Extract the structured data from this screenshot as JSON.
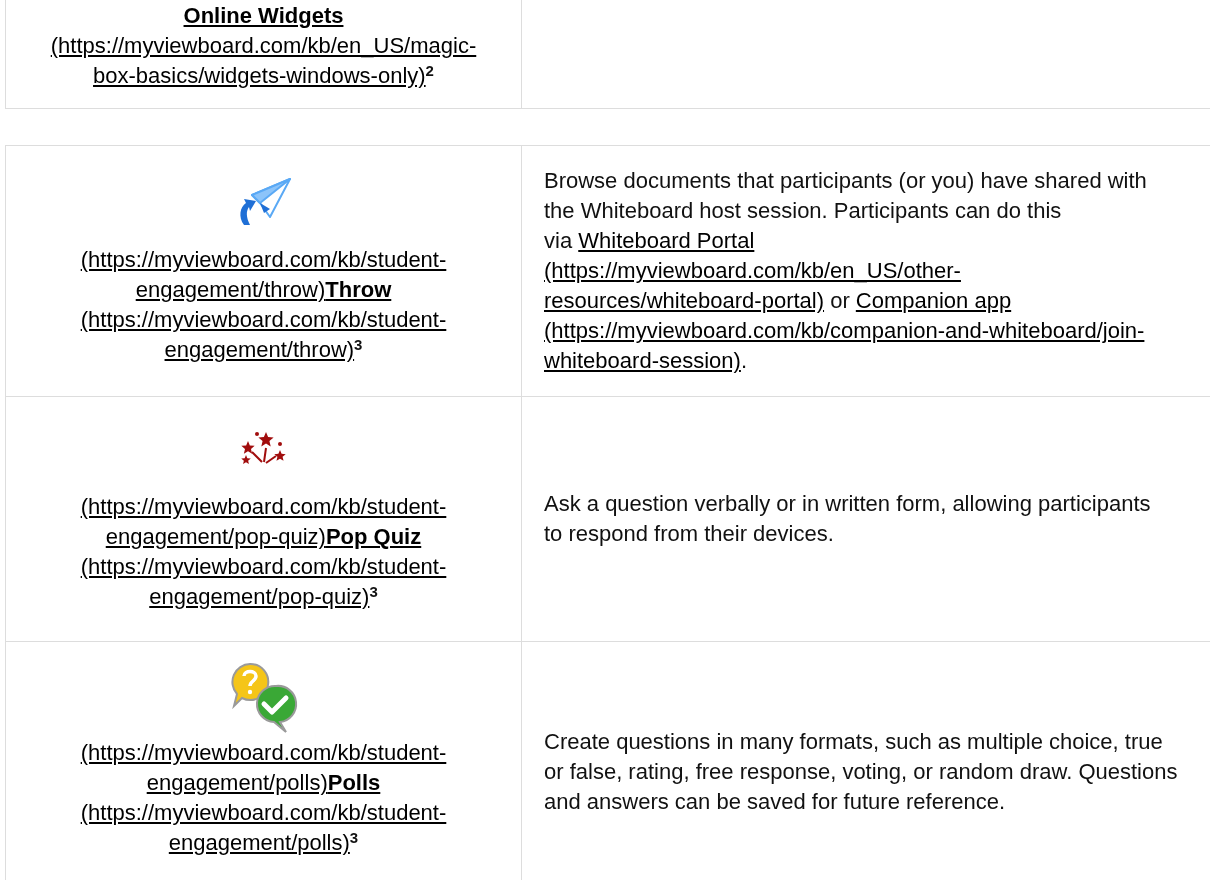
{
  "tables": [
    {
      "rows": [
        {
          "left_lines": [
            [
              {
                "kind": "title",
                "text": "Online Widgets"
              }
            ],
            [
              {
                "kind": "link",
                "text": "(https://myviewboard.com/kb/en_US/magic-"
              }
            ],
            [
              {
                "kind": "link",
                "text": "box-basics/widgets-windows-only)"
              },
              {
                "kind": "footnote",
                "text": "2"
              }
            ]
          ]
        }
      ]
    },
    {
      "rows": [
        {
          "kind": "throw",
          "left_lines": [
            [
              {
                "kind": "link",
                "text": "(https://myviewboard.com/kb/student-"
              }
            ],
            [
              {
                "kind": "link",
                "text": "engagement/throw)"
              },
              {
                "kind": "title",
                "text": "Throw"
              }
            ],
            [
              {
                "kind": "link",
                "text": "(https://myviewboard.com/kb/student-"
              }
            ],
            [
              {
                "kind": "link",
                "text": "engagement/throw)"
              },
              {
                "kind": "footnote",
                "text": "3"
              }
            ]
          ],
          "right_lines": [
            [
              {
                "kind": "text",
                "text": "Browse documents that participants (or you) have shared with"
              }
            ],
            [
              {
                "kind": "text",
                "text": "the Whiteboard host session. Participants can do this"
              }
            ],
            [
              {
                "kind": "text",
                "text": "via "
              },
              {
                "kind": "link",
                "text": "Whiteboard Portal"
              }
            ],
            [
              {
                "kind": "link",
                "text": "(https://myviewboard.com/kb/en_US/other-"
              }
            ],
            [
              {
                "kind": "link",
                "text": "resources/whiteboard-portal)"
              },
              {
                "kind": "text",
                "text": " or "
              },
              {
                "kind": "link",
                "text": "Companion app"
              }
            ],
            [
              {
                "kind": "link",
                "text": "(https://myviewboard.com/kb/companion-and-whiteboard/join-"
              }
            ],
            [
              {
                "kind": "link",
                "text": "whiteboard-session)"
              },
              {
                "kind": "text",
                "text": "."
              }
            ]
          ]
        },
        {
          "kind": "quiz",
          "left_lines": [
            [
              {
                "kind": "link",
                "text": "(https://myviewboard.com/kb/student-"
              }
            ],
            [
              {
                "kind": "link",
                "text": "engagement/pop-quiz)"
              },
              {
                "kind": "title",
                "text": "Pop Quiz"
              }
            ],
            [
              {
                "kind": "link",
                "text": "(https://myviewboard.com/kb/student-"
              }
            ],
            [
              {
                "kind": "link",
                "text": "engagement/pop-quiz)"
              },
              {
                "kind": "footnote",
                "text": "3"
              }
            ]
          ],
          "right_lines": [
            [
              {
                "kind": "text",
                "text": "Ask a question verbally or in written form, allowing participants"
              }
            ],
            [
              {
                "kind": "text",
                "text": "to respond from their devices."
              }
            ]
          ]
        },
        {
          "kind": "polls",
          "left_lines": [
            [
              {
                "kind": "link",
                "text": "(https://myviewboard.com/kb/student-"
              }
            ],
            [
              {
                "kind": "link",
                "text": "engagement/polls)"
              },
              {
                "kind": "title",
                "text": "Polls"
              }
            ],
            [
              {
                "kind": "link",
                "text": "(https://myviewboard.com/kb/student-"
              }
            ],
            [
              {
                "kind": "link",
                "text": "engagement/polls)"
              },
              {
                "kind": "footnote",
                "text": "3"
              }
            ]
          ],
          "right_lines": [
            [
              {
                "kind": "text",
                "text": "Create questions in many formats, such as multiple choice, true"
              }
            ],
            [
              {
                "kind": "text",
                "text": "or false, rating, free response, voting, or random draw. Questions"
              }
            ],
            [
              {
                "kind": "text",
                "text": "and answers can be saved for future reference."
              }
            ]
          ]
        }
      ]
    }
  ]
}
